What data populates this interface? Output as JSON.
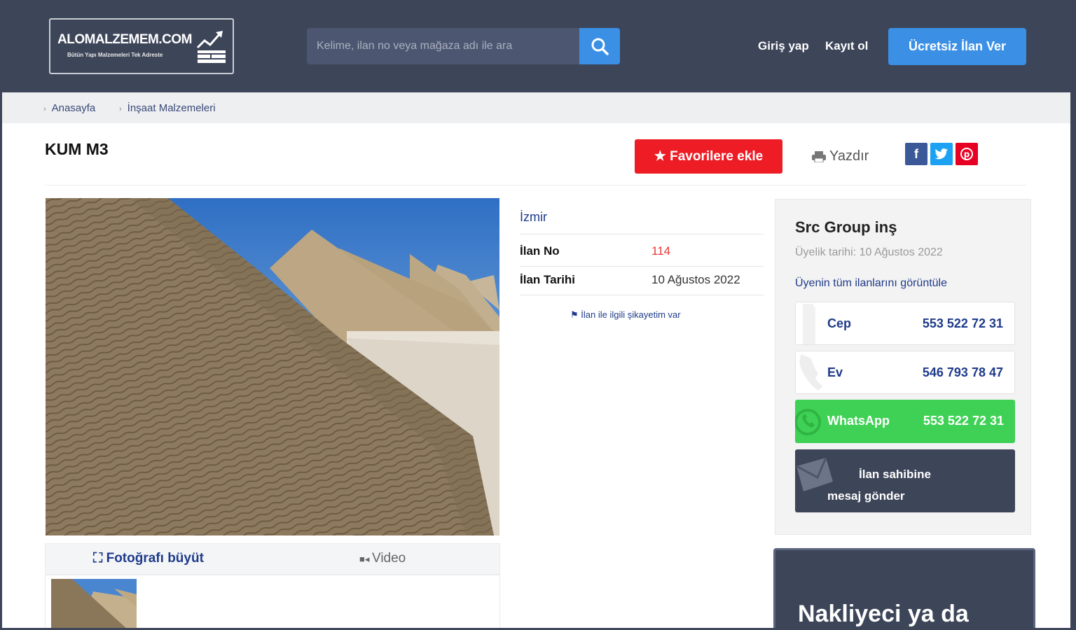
{
  "header": {
    "logo_title": "ALOMALZEMEM.COM",
    "logo_subtitle": "Bütün Yapı Malzemeleri Tek Adreste",
    "search_placeholder": "Kelime, ilan no veya mağaza adı ile ara",
    "login": "Giriş yap",
    "register": "Kayıt ol",
    "post_ad": "Ücretsiz İlan Ver"
  },
  "breadcrumb": [
    "Anasayfa",
    "İnşaat Malzemeleri"
  ],
  "listing": {
    "title": "KUM M3",
    "favorite_label": "★ Favorilere ekle",
    "print_label": "Yazdır",
    "city": "İzmir",
    "ad_no_label": "İlan No",
    "ad_no_value": "114",
    "ad_date_label": "İlan Tarihi",
    "ad_date_value": "10 Ağustos 2022",
    "complaint_label": "İlan ile ilgili şikayetim var",
    "enlarge_label": "Fotoğrafı büyüt",
    "video_label": "Video"
  },
  "seller": {
    "name": "Src Group inş",
    "member_since": "Üyelik tarihi: 10 Ağustos 2022",
    "all_ads": "Üyenin tüm ilanlarını görüntüle",
    "phones": [
      {
        "label": "Cep",
        "number": "553 522 72 31"
      },
      {
        "label": "Ev",
        "number": "546 793 78 47"
      }
    ],
    "whatsapp_label": "WhatsApp",
    "whatsapp_number": "553 522 72 31",
    "message_label": "İlan sahibine mesaj gönder"
  },
  "ad_banner": "Nakliyeci ya da",
  "colors": {
    "header_bg": "#3d4559",
    "accent_blue": "#3b90e6",
    "favorite_red": "#ee1c24",
    "whatsapp_green": "#3fd155",
    "link_blue": "#1f3b8a",
    "ad_no_red": "#e53935"
  },
  "icons": [
    "search-icon",
    "printer-icon",
    "facebook-icon",
    "twitter-icon",
    "pinterest-icon",
    "flag-icon",
    "expand-icon",
    "video-icon",
    "phone-icon",
    "whatsapp-icon",
    "envelope-icon"
  ]
}
